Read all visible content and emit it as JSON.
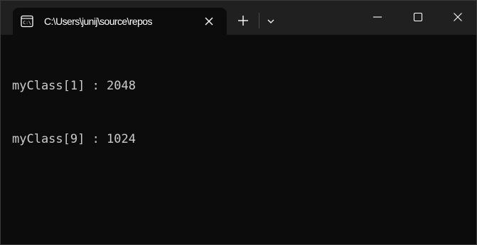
{
  "tab": {
    "title": "C:\\Users\\junij\\source\\repos",
    "icon": "terminal-icon"
  },
  "titlebar": {
    "new_tab_icon": "plus-icon",
    "dropdown_icon": "chevron-down-icon",
    "minimize_icon": "minimize-icon",
    "maximize_icon": "maximize-icon",
    "close_icon": "close-icon"
  },
  "console": {
    "lines": [
      "myClass[1] : 2048",
      "myClass[9] : 1024"
    ]
  },
  "colors": {
    "titlebar_bg": "#202020",
    "terminal_bg": "#0c0c0c",
    "text": "#cccccc"
  }
}
